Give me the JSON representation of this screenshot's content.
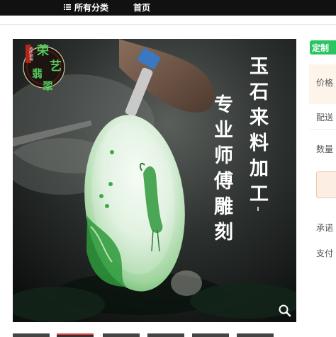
{
  "nav": {
    "category_label": "所有分类",
    "home_label": "首页"
  },
  "product_image": {
    "logo_text": [
      "荣",
      "艺",
      "翡",
      "翠"
    ],
    "logo_small_text": "专业翡翠",
    "headline_right": [
      "玉",
      "石",
      "来",
      "料",
      "加",
      "工"
    ],
    "headline_left": [
      "专",
      "业",
      "师",
      "傅",
      "雕",
      "刻"
    ]
  },
  "side_panel": {
    "badge": "定制",
    "price_label": "价格",
    "shipping_label": "配送",
    "quantity_label": "数量",
    "promise_label": "承诺",
    "payment_label": "支付"
  },
  "colors": {
    "badge_green": "#29c561",
    "topbar": "#111111",
    "thumb_active_border": "#e4393c"
  },
  "icons": {
    "menu": "menu-icon",
    "zoom": "magnifier-icon"
  }
}
